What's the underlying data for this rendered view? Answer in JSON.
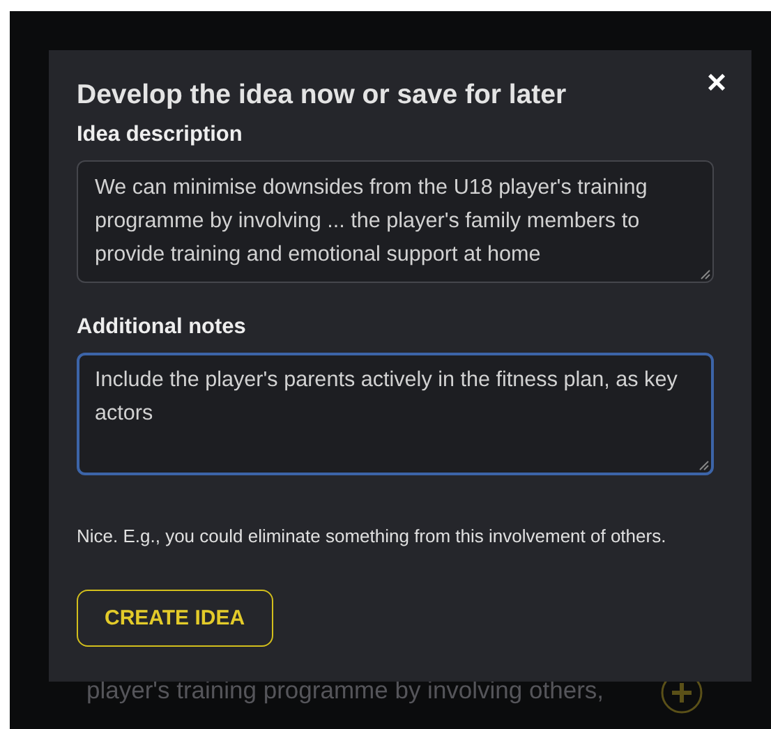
{
  "background": {
    "lines": [
      "player's training programme by involving others,"
    ]
  },
  "dialog": {
    "title": "Develop the idea now or save for later",
    "close": "×",
    "fields": [
      {
        "label": "Idea description",
        "value": "We can minimise downsides from the U18 player's training programme by involving ... the player's family members to provide training and emotional support at home",
        "focused": false
      },
      {
        "label": "Additional notes",
        "value": "Include the player's parents actively in the fitness plan, as key actors",
        "focused": true
      }
    ],
    "hint": "Nice. E.g., you could eliminate something from this involvement of others.",
    "button": "CREATE IDEA"
  }
}
